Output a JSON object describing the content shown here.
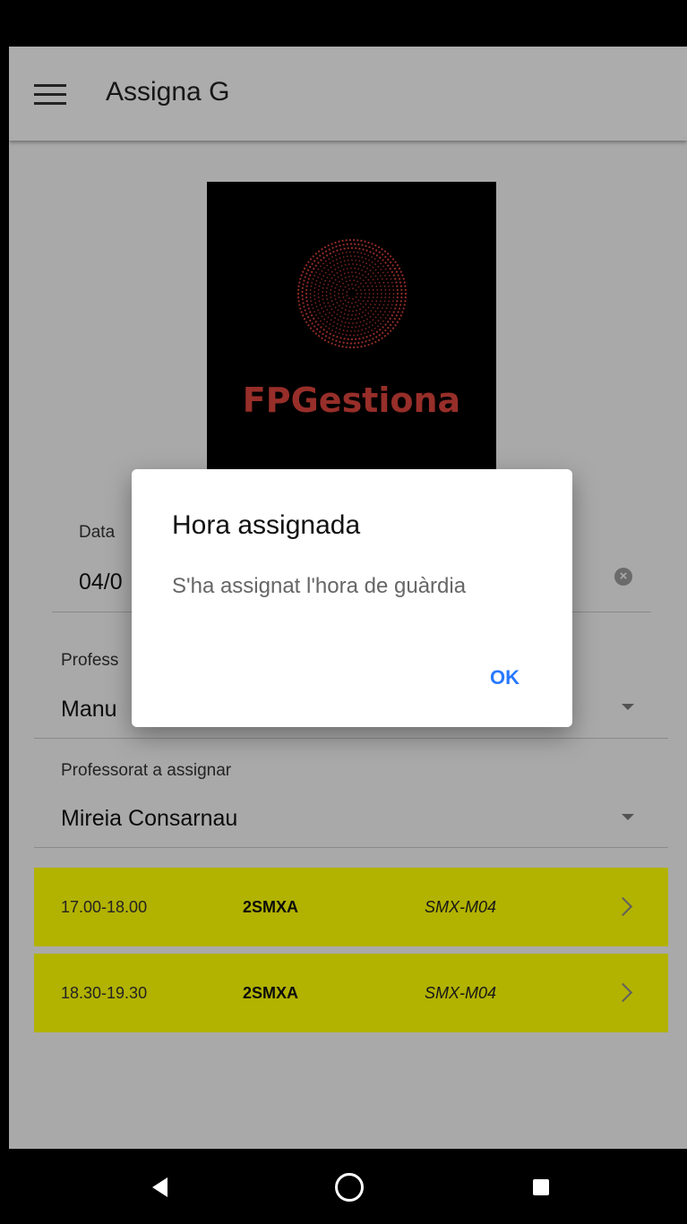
{
  "app": {
    "title": "Assigna G"
  },
  "logo": {
    "text": "FPGestiona",
    "accent_color": "#d9423b"
  },
  "form": {
    "date": {
      "label": "Data",
      "value": "04/0"
    },
    "absent_teacher": {
      "label": "Profess",
      "value": "Manu"
    },
    "assign_teacher": {
      "label": "Professorat a assignar",
      "value": "Mireia Consarnau"
    }
  },
  "slots": [
    {
      "time": "17.00-18.00",
      "group": "2SMXA",
      "module": "SMX-M04"
    },
    {
      "time": "18.30-19.30",
      "group": "2SMXA",
      "module": "SMX-M04"
    }
  ],
  "slot_color": "#ffff00",
  "dialog": {
    "title": "Hora assignada",
    "message": "S'ha assignat l'hora de guàrdia",
    "ok_label": "OK",
    "accent_color": "#2979ff"
  },
  "icons": [
    "menu-icon",
    "clear-icon",
    "chevron-down-icon",
    "chevron-right-icon",
    "back-icon",
    "home-icon",
    "recents-icon"
  ]
}
